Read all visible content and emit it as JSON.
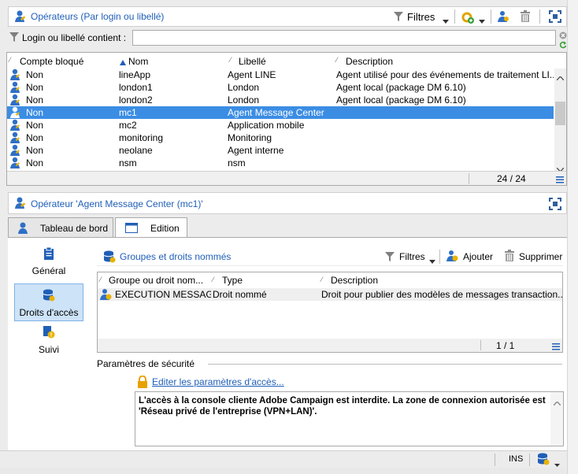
{
  "top": {
    "title": "Opérateurs (Par login ou libellé)",
    "filters_label": "Filtres",
    "filter_label": "Login ou libellé contient :",
    "filter_value": ""
  },
  "list": {
    "headers": [
      "Compte bloqué",
      "Nom",
      "Libellé",
      "Description"
    ],
    "rows": [
      {
        "blocked": "Non",
        "name": "lineApp",
        "label": "Agent LINE",
        "desc": "Agent utilisé pour des événements de traitement LI..."
      },
      {
        "blocked": "Non",
        "name": "london1",
        "label": "London",
        "desc": "Agent local (package DM 6.10)"
      },
      {
        "blocked": "Non",
        "name": "london2",
        "label": "London",
        "desc": "Agent local (package DM 6.10)"
      },
      {
        "blocked": "Non",
        "name": "mc1",
        "label": "Agent Message Center",
        "desc": ""
      },
      {
        "blocked": "Non",
        "name": "mc2",
        "label": "Application mobile",
        "desc": ""
      },
      {
        "blocked": "Non",
        "name": "monitoring",
        "label": "Monitoring",
        "desc": ""
      },
      {
        "blocked": "Non",
        "name": "neolane",
        "label": "Agent interne",
        "desc": ""
      },
      {
        "blocked": "Non",
        "name": "nsm",
        "label": "nsm",
        "desc": ""
      }
    ],
    "count": "24 / 24"
  },
  "detail": {
    "title": "Opérateur 'Agent Message Center (mc1)'",
    "tabs": [
      "Tableau de bord",
      "Edition"
    ],
    "nav": [
      "Général",
      "Droits d'accès",
      "Suivi"
    ],
    "section_title": "Groupes et droits nommés",
    "filters_label": "Filtres",
    "add_label": "Ajouter",
    "delete_label": "Supprimer",
    "rights_headers": [
      "Groupe ou droit nom...",
      "Type",
      "Description"
    ],
    "rights_rows": [
      {
        "name": "EXECUTION MESSAG...",
        "type": "Droit nommé",
        "desc": "Droit pour publier des modèles de messages transaction..."
      }
    ],
    "rights_count": "1 / 1",
    "security_label": "Paramètres de sécurité",
    "edit_link": "Editer les paramètres d'accès...",
    "security_text": "L'accès à la console cliente Adobe Campaign est interdite. La zone de connexion autorisée est 'Réseau privé de l'entreprise (VPN+LAN)'."
  },
  "status": {
    "ins": "INS"
  },
  "colors": {
    "accent": "#1f5fb8",
    "selection": "#3b8de4",
    "lock": "#e8a200"
  }
}
